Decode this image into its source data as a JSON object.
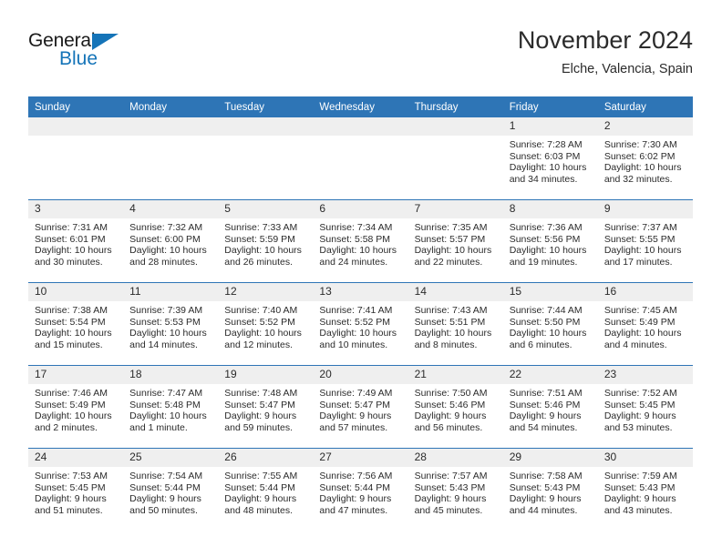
{
  "brand": {
    "name_part1": "General",
    "name_part2": "Blue",
    "accent_color": "#1574b8"
  },
  "header": {
    "month_title": "November 2024",
    "location": "Elche, Valencia, Spain"
  },
  "theme": {
    "header_blue": "#2e75b6",
    "daynum_gray": "#efefef",
    "text_color": "#2b2b2b"
  },
  "weekday_headers": [
    "Sunday",
    "Monday",
    "Tuesday",
    "Wednesday",
    "Thursday",
    "Friday",
    "Saturday"
  ],
  "labels": {
    "sunrise_prefix": "Sunrise:",
    "sunset_prefix": "Sunset:",
    "daylight_prefix": "Daylight:"
  },
  "weeks": [
    [
      {
        "day": "",
        "sunrise": "",
        "sunset": "",
        "daylight_line1": "",
        "daylight_line2": ""
      },
      {
        "day": "",
        "sunrise": "",
        "sunset": "",
        "daylight_line1": "",
        "daylight_line2": ""
      },
      {
        "day": "",
        "sunrise": "",
        "sunset": "",
        "daylight_line1": "",
        "daylight_line2": ""
      },
      {
        "day": "",
        "sunrise": "",
        "sunset": "",
        "daylight_line1": "",
        "daylight_line2": ""
      },
      {
        "day": "",
        "sunrise": "",
        "sunset": "",
        "daylight_line1": "",
        "daylight_line2": ""
      },
      {
        "day": "1",
        "sunrise": "Sunrise: 7:28 AM",
        "sunset": "Sunset: 6:03 PM",
        "daylight_line1": "Daylight: 10 hours",
        "daylight_line2": "and 34 minutes."
      },
      {
        "day": "2",
        "sunrise": "Sunrise: 7:30 AM",
        "sunset": "Sunset: 6:02 PM",
        "daylight_line1": "Daylight: 10 hours",
        "daylight_line2": "and 32 minutes."
      }
    ],
    [
      {
        "day": "3",
        "sunrise": "Sunrise: 7:31 AM",
        "sunset": "Sunset: 6:01 PM",
        "daylight_line1": "Daylight: 10 hours",
        "daylight_line2": "and 30 minutes."
      },
      {
        "day": "4",
        "sunrise": "Sunrise: 7:32 AM",
        "sunset": "Sunset: 6:00 PM",
        "daylight_line1": "Daylight: 10 hours",
        "daylight_line2": "and 28 minutes."
      },
      {
        "day": "5",
        "sunrise": "Sunrise: 7:33 AM",
        "sunset": "Sunset: 5:59 PM",
        "daylight_line1": "Daylight: 10 hours",
        "daylight_line2": "and 26 minutes."
      },
      {
        "day": "6",
        "sunrise": "Sunrise: 7:34 AM",
        "sunset": "Sunset: 5:58 PM",
        "daylight_line1": "Daylight: 10 hours",
        "daylight_line2": "and 24 minutes."
      },
      {
        "day": "7",
        "sunrise": "Sunrise: 7:35 AM",
        "sunset": "Sunset: 5:57 PM",
        "daylight_line1": "Daylight: 10 hours",
        "daylight_line2": "and 22 minutes."
      },
      {
        "day": "8",
        "sunrise": "Sunrise: 7:36 AM",
        "sunset": "Sunset: 5:56 PM",
        "daylight_line1": "Daylight: 10 hours",
        "daylight_line2": "and 19 minutes."
      },
      {
        "day": "9",
        "sunrise": "Sunrise: 7:37 AM",
        "sunset": "Sunset: 5:55 PM",
        "daylight_line1": "Daylight: 10 hours",
        "daylight_line2": "and 17 minutes."
      }
    ],
    [
      {
        "day": "10",
        "sunrise": "Sunrise: 7:38 AM",
        "sunset": "Sunset: 5:54 PM",
        "daylight_line1": "Daylight: 10 hours",
        "daylight_line2": "and 15 minutes."
      },
      {
        "day": "11",
        "sunrise": "Sunrise: 7:39 AM",
        "sunset": "Sunset: 5:53 PM",
        "daylight_line1": "Daylight: 10 hours",
        "daylight_line2": "and 14 minutes."
      },
      {
        "day": "12",
        "sunrise": "Sunrise: 7:40 AM",
        "sunset": "Sunset: 5:52 PM",
        "daylight_line1": "Daylight: 10 hours",
        "daylight_line2": "and 12 minutes."
      },
      {
        "day": "13",
        "sunrise": "Sunrise: 7:41 AM",
        "sunset": "Sunset: 5:52 PM",
        "daylight_line1": "Daylight: 10 hours",
        "daylight_line2": "and 10 minutes."
      },
      {
        "day": "14",
        "sunrise": "Sunrise: 7:43 AM",
        "sunset": "Sunset: 5:51 PM",
        "daylight_line1": "Daylight: 10 hours",
        "daylight_line2": "and 8 minutes."
      },
      {
        "day": "15",
        "sunrise": "Sunrise: 7:44 AM",
        "sunset": "Sunset: 5:50 PM",
        "daylight_line1": "Daylight: 10 hours",
        "daylight_line2": "and 6 minutes."
      },
      {
        "day": "16",
        "sunrise": "Sunrise: 7:45 AM",
        "sunset": "Sunset: 5:49 PM",
        "daylight_line1": "Daylight: 10 hours",
        "daylight_line2": "and 4 minutes."
      }
    ],
    [
      {
        "day": "17",
        "sunrise": "Sunrise: 7:46 AM",
        "sunset": "Sunset: 5:49 PM",
        "daylight_line1": "Daylight: 10 hours",
        "daylight_line2": "and 2 minutes."
      },
      {
        "day": "18",
        "sunrise": "Sunrise: 7:47 AM",
        "sunset": "Sunset: 5:48 PM",
        "daylight_line1": "Daylight: 10 hours",
        "daylight_line2": "and 1 minute."
      },
      {
        "day": "19",
        "sunrise": "Sunrise: 7:48 AM",
        "sunset": "Sunset: 5:47 PM",
        "daylight_line1": "Daylight: 9 hours",
        "daylight_line2": "and 59 minutes."
      },
      {
        "day": "20",
        "sunrise": "Sunrise: 7:49 AM",
        "sunset": "Sunset: 5:47 PM",
        "daylight_line1": "Daylight: 9 hours",
        "daylight_line2": "and 57 minutes."
      },
      {
        "day": "21",
        "sunrise": "Sunrise: 7:50 AM",
        "sunset": "Sunset: 5:46 PM",
        "daylight_line1": "Daylight: 9 hours",
        "daylight_line2": "and 56 minutes."
      },
      {
        "day": "22",
        "sunrise": "Sunrise: 7:51 AM",
        "sunset": "Sunset: 5:46 PM",
        "daylight_line1": "Daylight: 9 hours",
        "daylight_line2": "and 54 minutes."
      },
      {
        "day": "23",
        "sunrise": "Sunrise: 7:52 AM",
        "sunset": "Sunset: 5:45 PM",
        "daylight_line1": "Daylight: 9 hours",
        "daylight_line2": "and 53 minutes."
      }
    ],
    [
      {
        "day": "24",
        "sunrise": "Sunrise: 7:53 AM",
        "sunset": "Sunset: 5:45 PM",
        "daylight_line1": "Daylight: 9 hours",
        "daylight_line2": "and 51 minutes."
      },
      {
        "day": "25",
        "sunrise": "Sunrise: 7:54 AM",
        "sunset": "Sunset: 5:44 PM",
        "daylight_line1": "Daylight: 9 hours",
        "daylight_line2": "and 50 minutes."
      },
      {
        "day": "26",
        "sunrise": "Sunrise: 7:55 AM",
        "sunset": "Sunset: 5:44 PM",
        "daylight_line1": "Daylight: 9 hours",
        "daylight_line2": "and 48 minutes."
      },
      {
        "day": "27",
        "sunrise": "Sunrise: 7:56 AM",
        "sunset": "Sunset: 5:44 PM",
        "daylight_line1": "Daylight: 9 hours",
        "daylight_line2": "and 47 minutes."
      },
      {
        "day": "28",
        "sunrise": "Sunrise: 7:57 AM",
        "sunset": "Sunset: 5:43 PM",
        "daylight_line1": "Daylight: 9 hours",
        "daylight_line2": "and 45 minutes."
      },
      {
        "day": "29",
        "sunrise": "Sunrise: 7:58 AM",
        "sunset": "Sunset: 5:43 PM",
        "daylight_line1": "Daylight: 9 hours",
        "daylight_line2": "and 44 minutes."
      },
      {
        "day": "30",
        "sunrise": "Sunrise: 7:59 AM",
        "sunset": "Sunset: 5:43 PM",
        "daylight_line1": "Daylight: 9 hours",
        "daylight_line2": "and 43 minutes."
      }
    ]
  ]
}
